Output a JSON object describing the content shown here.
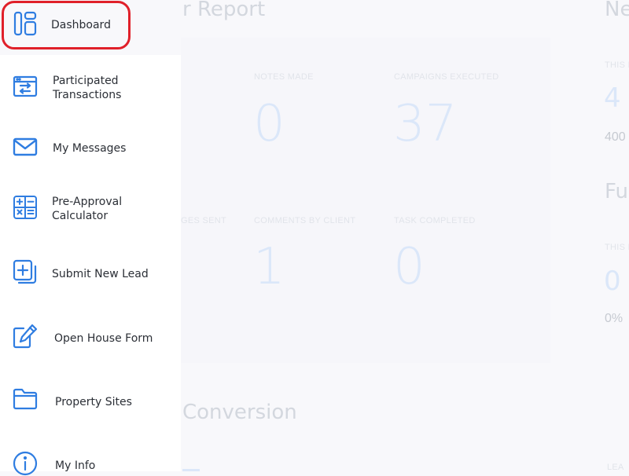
{
  "background": {
    "report_title": "r Report",
    "conversion_title": "Conversion",
    "right_title_top": "Ne",
    "right_title_mid": "Fu",
    "stats_row1": [
      {
        "label": "NOTES MADE",
        "value": "0"
      },
      {
        "label": "CAMPAIGNS EXECUTED",
        "value": "37"
      }
    ],
    "stats_row2": [
      {
        "label": "GES SENT",
        "value": ""
      },
      {
        "label": "COMMENTS BY CLIENT",
        "value": "1"
      },
      {
        "label": "TASK COMPLETED",
        "value": "0"
      }
    ],
    "right_col": {
      "label_top": "THIS M",
      "value_top": "4",
      "sub_top": "400",
      "label_mid": "THIS M",
      "value_mid": "0",
      "sub_mid": "0%",
      "bottom_label": "LEA"
    }
  },
  "sidebar": {
    "items": [
      {
        "label": "Dashboard",
        "icon": "dashboard-icon"
      },
      {
        "label": "Participated\nTransactions",
        "icon": "transactions-icon"
      },
      {
        "label": "My Messages",
        "icon": "envelope-icon"
      },
      {
        "label": "Pre-Approval\nCalculator",
        "icon": "calculator-icon"
      },
      {
        "label": "Submit New Lead",
        "icon": "add-document-icon"
      },
      {
        "label": "Open House Form",
        "icon": "edit-form-icon"
      },
      {
        "label": "Property Sites",
        "icon": "folder-icon"
      },
      {
        "label": "My Info",
        "icon": "info-icon"
      }
    ]
  },
  "colors": {
    "icon": "#2f7de1",
    "highlight": "#e0202a",
    "text": "#2b2f36"
  }
}
